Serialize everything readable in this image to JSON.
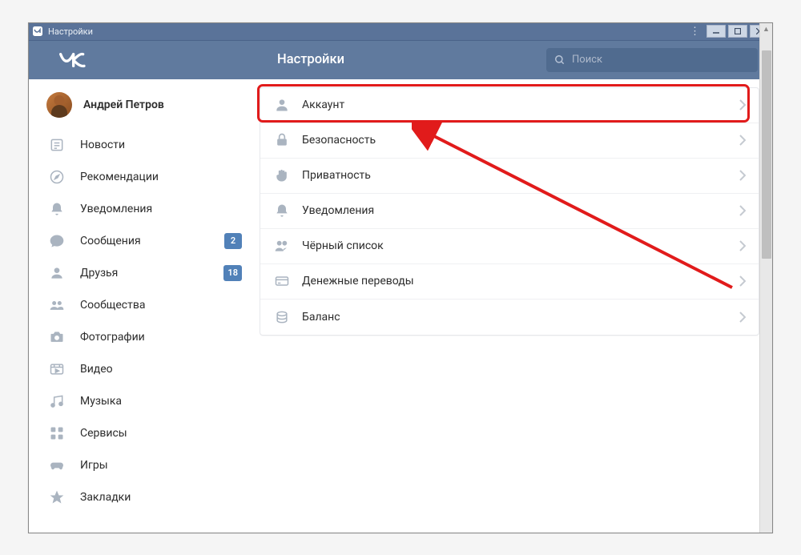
{
  "window": {
    "title": "Настройки"
  },
  "header": {
    "title": "Настройки",
    "search_placeholder": "Поиск"
  },
  "sidebar": {
    "profile_name": "Андрей Петров",
    "items": [
      {
        "label": "Новости",
        "icon": "newspaper-icon"
      },
      {
        "label": "Рекомендации",
        "icon": "compass-icon"
      },
      {
        "label": "Уведомления",
        "icon": "bell-icon"
      },
      {
        "label": "Сообщения",
        "icon": "chat-icon",
        "badge": "2"
      },
      {
        "label": "Друзья",
        "icon": "user-icon",
        "badge": "18"
      },
      {
        "label": "Сообщества",
        "icon": "users-icon"
      },
      {
        "label": "Фотографии",
        "icon": "camera-icon"
      },
      {
        "label": "Видео",
        "icon": "video-icon"
      },
      {
        "label": "Музыка",
        "icon": "music-icon"
      },
      {
        "label": "Сервисы",
        "icon": "grid-icon"
      },
      {
        "label": "Игры",
        "icon": "gamepad-icon"
      },
      {
        "label": "Закладки",
        "icon": "star-icon"
      }
    ]
  },
  "settings": [
    {
      "label": "Аккаунт",
      "icon": "person-icon",
      "highlighted": true
    },
    {
      "label": "Безопасность",
      "icon": "lock-icon"
    },
    {
      "label": "Приватность",
      "icon": "hand-icon"
    },
    {
      "label": "Уведомления",
      "icon": "bell-icon"
    },
    {
      "label": "Чёрный список",
      "icon": "users-minus-icon"
    },
    {
      "label": "Денежные переводы",
      "icon": "card-icon"
    },
    {
      "label": "Баланс",
      "icon": "coins-icon"
    }
  ]
}
